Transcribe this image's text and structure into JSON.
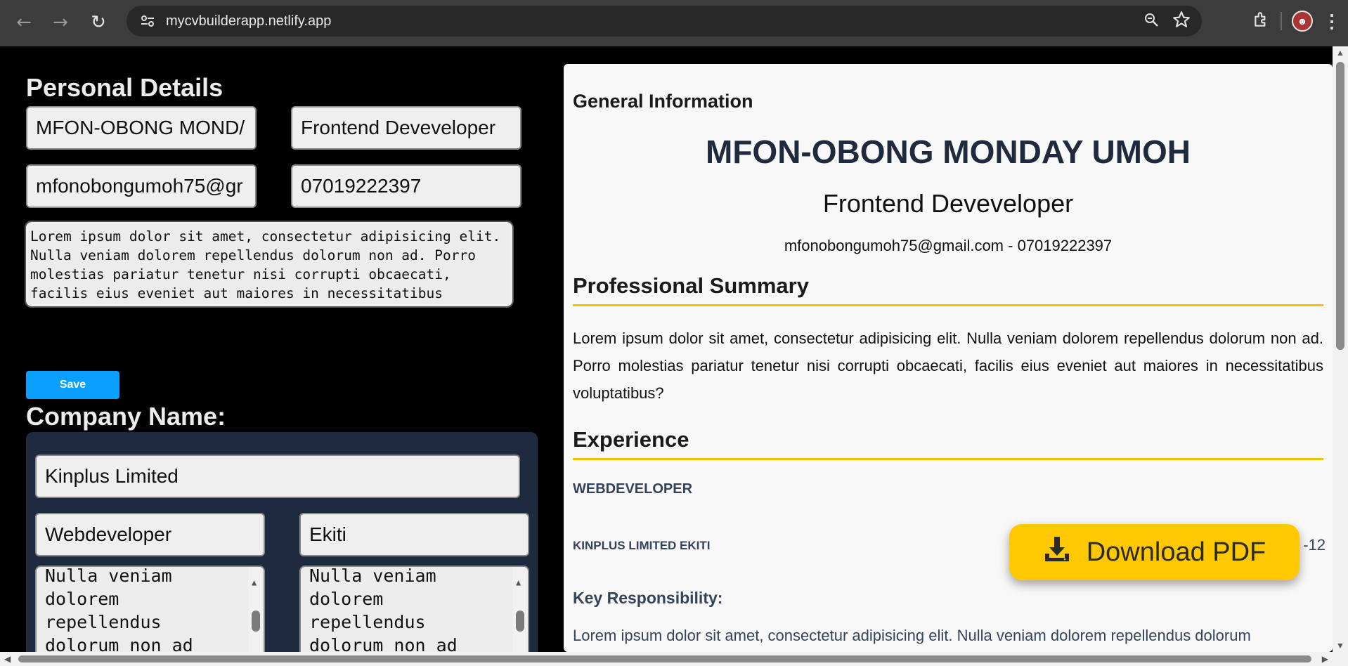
{
  "browser": {
    "url": "mycvbuilderapp.netlify.app",
    "back_icon": "arrow-left-icon",
    "forward_icon": "arrow-right-icon",
    "reload_icon": "reload-icon"
  },
  "form": {
    "personal_heading": "Personal Details",
    "name_value": "MFON-OBONG MOND/",
    "title_value": "Frontend Deveveloper",
    "email_value": "mfonobongumoh75@gr",
    "phone_value": "07019222397",
    "summary_value": "Lorem ipsum dolor sit amet, consectetur adipisicing elit. Nulla veniam dolorem repellendus dolorum non ad. Porro molestias pariatur tenetur nisi corrupti obcaecati, facilis eius eveniet aut maiores in necessitatibus voluptatibus?",
    "save_label": "Save",
    "company_heading": "Company Name:",
    "company_value": "Kinplus Limited",
    "job_value": "Webdeveloper",
    "location_value": "Ekiti",
    "desc_left_value": "Nulla veniam dolorem repellendus dolorum non ad",
    "desc_right_value": "Nulla veniam dolorem repellendus dolorum non ad"
  },
  "preview": {
    "general_heading": "General Information",
    "name": "MFON-OBONG MONDAY UMOH",
    "role": "Frontend Deveveloper",
    "contact": "mfonobongumoh75@gmail.com - 07019222397",
    "summary_heading": "Professional Summary",
    "summary": "Lorem ipsum dolor sit amet, consectetur adipisicing elit. Nulla veniam dolorem repellendus dolorum non ad. Porro molestias pariatur tenetur nisi corrupti obcaecati, facilis eius eveniet aut maiores in necessitatibus voluptatibus?",
    "experience_heading": "Experience",
    "job_title": "WEBDEVELOPER",
    "company_line": "KINPLUS LIMITED EKITI",
    "date_fragment": "-12",
    "key_heading": "Key Responsibility:",
    "key_text": "Lorem ipsum dolor sit amet, consectetur adipisicing elit. Nulla veniam dolorem repellendus dolorum"
  },
  "download": {
    "label": "Download PDF",
    "icon": "download-icon"
  },
  "colors": {
    "accent_yellow": "#ffc800",
    "save_blue": "#0aa0ff",
    "heading_rule": "#f2c400",
    "company_panel": "#1e2a3e"
  }
}
